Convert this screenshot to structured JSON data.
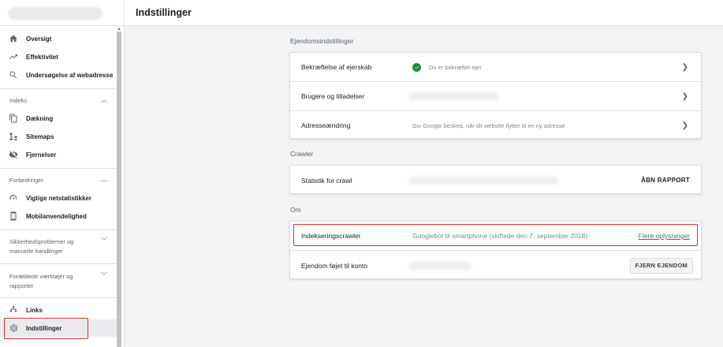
{
  "header": {
    "title": "Indstillinger"
  },
  "sidebar": {
    "items_top": [
      {
        "label": "Oversigt",
        "icon": "home-icon"
      },
      {
        "label": "Effektivitet",
        "icon": "trending-up-icon"
      },
      {
        "label": "Undersøgelse af webadresse",
        "icon": "search-icon"
      }
    ],
    "section_indeks": "Indeks",
    "items_indeks": [
      {
        "label": "Dækning",
        "icon": "copy-icon"
      },
      {
        "label": "Sitemaps",
        "icon": "sitemap-icon"
      },
      {
        "label": "Fjernelser",
        "icon": "eye-off-icon"
      }
    ],
    "section_forbedringer": "Forbedringer",
    "items_forbedringer": [
      {
        "label": "Vigtige netstatistikker",
        "icon": "speedometer-icon"
      },
      {
        "label": "Mobilanvendelighed",
        "icon": "smartphone-icon"
      }
    ],
    "section_sikkerhed_line1": "Sikkerhedsproblemer og",
    "section_sikkerhed_line2": "manuelle handlinger",
    "section_foraeldede_line1": "Forældede værktøjer og",
    "section_foraeldede_line2": "rapporter",
    "items_bottom": [
      {
        "label": "Links",
        "icon": "links-icon"
      },
      {
        "label": "Indstillinger",
        "icon": "gear-icon"
      }
    ]
  },
  "main": {
    "group1_title": "Ejendomsindstillinger",
    "verify_label": "Bekræftelse af ejerskab",
    "verify_value": "Du er bekræftet ejer",
    "users_label": "Brugere og tilladelser",
    "address_label": "Adresseændring",
    "address_value": "Giv Google besked, når dit website flytter til en ny adresse",
    "group2_title": "Crawler",
    "crawl_label": "Statistik for crawl",
    "crawl_action": "ÅBN RAPPORT",
    "group3_title": "Om",
    "indexing_label": "Indekseringscrawler",
    "indexing_value": "Googlebot til smartphone (skiftede den 7. september 2018)",
    "indexing_link": "Flere oplysninger",
    "added_label": "Ejendom føjet til konto",
    "added_action": "FJERN EJENDOM"
  },
  "colors": {
    "accent_red": "#d93025",
    "success_green": "#1e8e3e"
  }
}
